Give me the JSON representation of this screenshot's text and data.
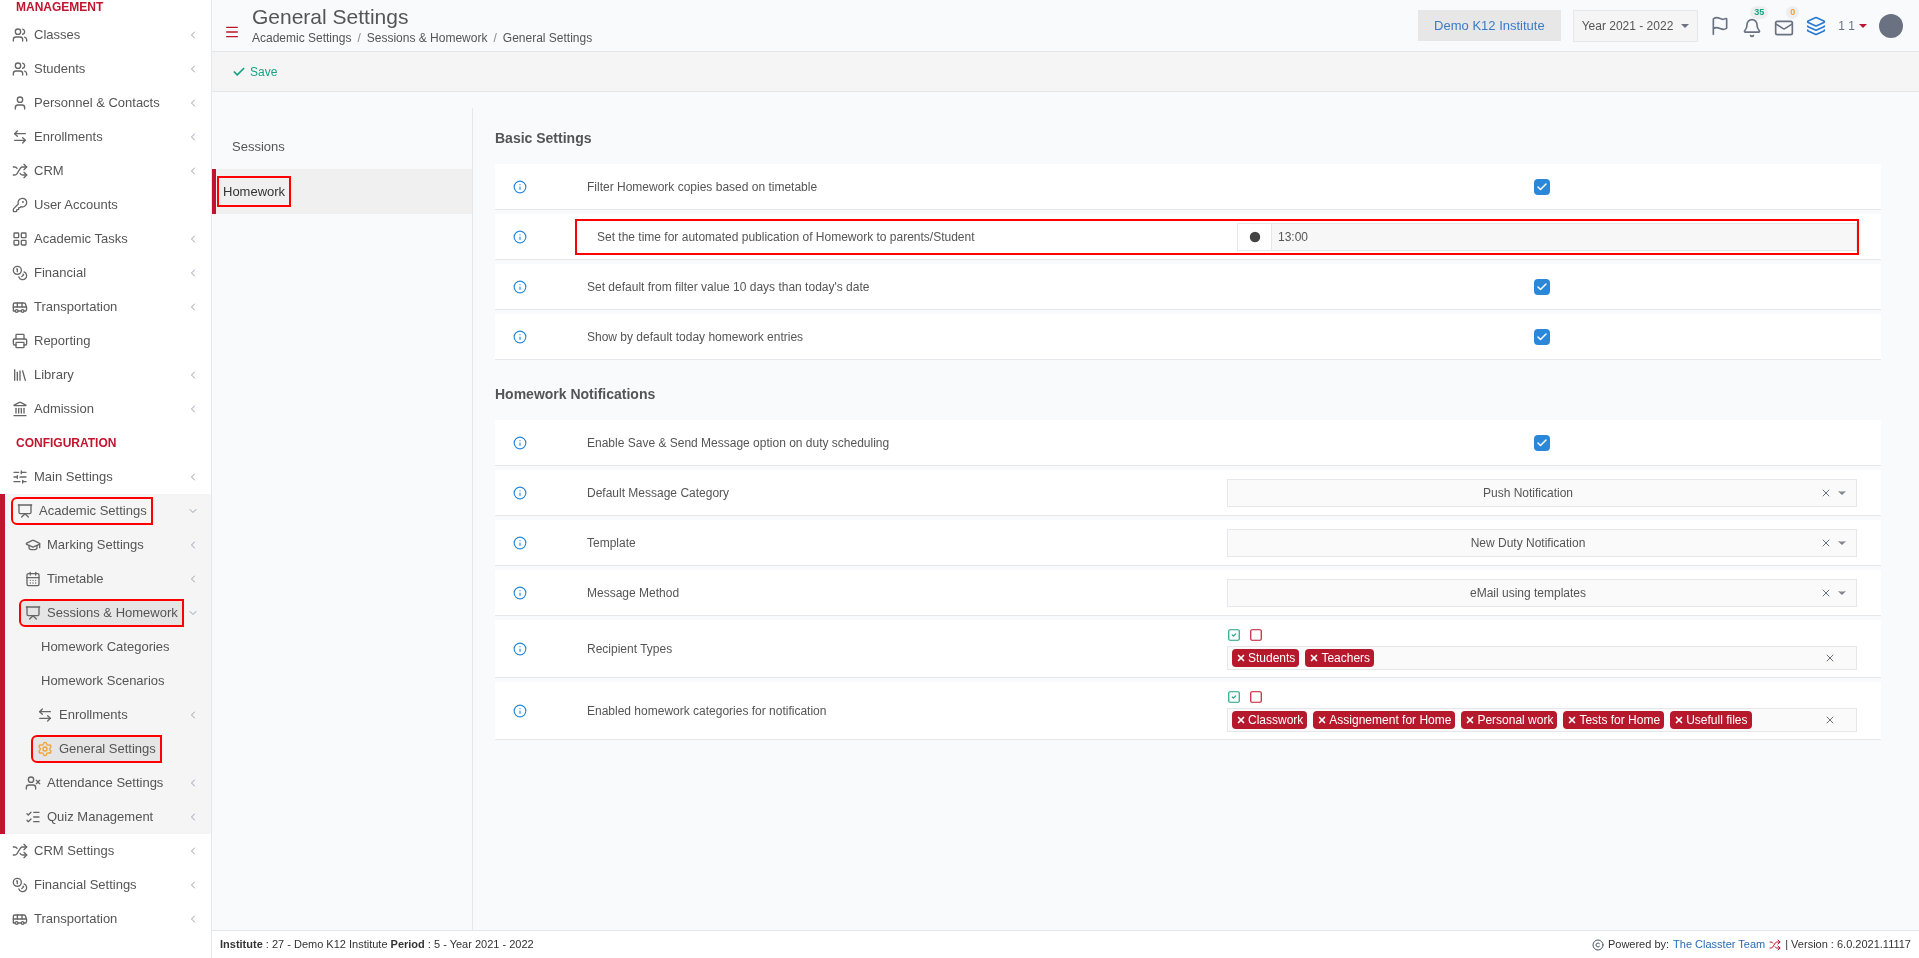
{
  "sidebar": [
    {
      "kind": "heading",
      "label": "MANAGEMENT"
    },
    {
      "kind": "item",
      "label": "Classes",
      "submenu": true,
      "expanded": false,
      "selected": false,
      "annotated": false
    },
    {
      "kind": "item",
      "label": "Students",
      "submenu": true,
      "expanded": false,
      "selected": false,
      "annotated": false
    },
    {
      "kind": "item",
      "label": "Personnel & Contacts",
      "submenu": true,
      "expanded": false,
      "selected": false,
      "annotated": false
    },
    {
      "kind": "item",
      "label": "Enrollments",
      "submenu": true,
      "expanded": false,
      "selected": false,
      "annotated": false
    },
    {
      "kind": "item",
      "label": "CRM",
      "submenu": true,
      "expanded": false,
      "selected": false,
      "annotated": false
    },
    {
      "kind": "item",
      "label": "User Accounts",
      "submenu": false,
      "selected": false,
      "annotated": false
    },
    {
      "kind": "item",
      "label": "Academic Tasks",
      "submenu": true,
      "expanded": false,
      "selected": false,
      "annotated": false
    },
    {
      "kind": "item",
      "label": "Financial",
      "submenu": true,
      "expanded": false,
      "selected": false,
      "annotated": false
    },
    {
      "kind": "item",
      "label": "Transportation",
      "submenu": true,
      "expanded": false,
      "selected": false,
      "annotated": false
    },
    {
      "kind": "item",
      "label": "Reporting",
      "submenu": false,
      "selected": false,
      "annotated": false
    },
    {
      "kind": "item",
      "label": "Library",
      "submenu": true,
      "expanded": false,
      "selected": false,
      "annotated": false
    },
    {
      "kind": "item",
      "label": "Admission",
      "submenu": true,
      "expanded": false,
      "selected": false,
      "annotated": false
    },
    {
      "kind": "heading",
      "label": "CONFIGURATION"
    },
    {
      "kind": "item",
      "label": "Main Settings",
      "submenu": true,
      "expanded": false,
      "selected": false,
      "annotated": false
    },
    {
      "kind": "item",
      "label": "Academic Settings",
      "submenu": true,
      "expanded": true,
      "selected": false,
      "annotated": true,
      "children": [
        {
          "label": "Marking Settings",
          "submenu": true,
          "expanded": false,
          "selected": false,
          "annotated": false
        },
        {
          "label": "Timetable",
          "submenu": true,
          "expanded": false,
          "selected": false,
          "annotated": false
        },
        {
          "label": "Sessions & Homework",
          "submenu": true,
          "expanded": true,
          "selected": true,
          "annotated": true,
          "children": [
            {
              "label": "Homework Categories",
              "submenu": false,
              "selected": false,
              "annotated": false,
              "icon": false
            },
            {
              "label": "Homework Scenarios",
              "submenu": false,
              "selected": false,
              "annotated": false,
              "icon": false
            },
            {
              "label": "Enrollments",
              "submenu": true,
              "expanded": false,
              "selected": false,
              "annotated": false,
              "icon": true
            },
            {
              "label": "General Settings",
              "submenu": false,
              "selected": true,
              "annotated": true,
              "icon": true
            }
          ]
        },
        {
          "label": "Attendance Settings",
          "submenu": true,
          "expanded": false,
          "selected": false,
          "annotated": false
        },
        {
          "label": "Quiz Management",
          "submenu": true,
          "expanded": false,
          "selected": false,
          "annotated": false
        }
      ]
    },
    {
      "kind": "item",
      "label": "CRM Settings",
      "submenu": true,
      "expanded": false,
      "selected": false,
      "annotated": false
    },
    {
      "kind": "item",
      "label": "Financial Settings",
      "submenu": true,
      "expanded": false,
      "selected": false,
      "annotated": false
    },
    {
      "kind": "item",
      "label": "Transportation",
      "submenu": true,
      "expanded": false,
      "selected": false,
      "annotated": false
    }
  ],
  "header": {
    "title": "General Settings",
    "breadcrumb": [
      "Academic Settings",
      "Sessions & Homework",
      "General Settings"
    ],
    "breadcrumb_separator": "/",
    "institute": "Demo K12 Institute",
    "year": "Year 2021 - 2022",
    "notifications": "35",
    "messages": "0",
    "user": "1 1"
  },
  "toolbar": {
    "save": "Save"
  },
  "subnav": [
    {
      "label": "Sessions",
      "selected": false,
      "annotated": false
    },
    {
      "label": "Homework",
      "selected": true,
      "annotated": true
    }
  ],
  "sections": [
    {
      "title": "Basic Settings",
      "rows": [
        {
          "kind": "checkbox",
          "label": "Filter Homework copies based on timetable",
          "checked": true,
          "annotated": false
        },
        {
          "kind": "time",
          "label": "Set the time for automated publication of Homework to parents/Student",
          "value": "13:00",
          "annotated": true
        },
        {
          "kind": "checkbox",
          "label": "Set default from filter value 10 days than today's date",
          "checked": true,
          "annotated": false
        },
        {
          "kind": "checkbox",
          "label": "Show by default today homework entries",
          "checked": true,
          "annotated": false
        }
      ]
    },
    {
      "title": "Homework Notifications",
      "rows": [
        {
          "kind": "checkbox",
          "label": "Enable Save & Send Message option on duty scheduling",
          "checked": true,
          "annotated": false
        },
        {
          "kind": "select",
          "label": "Default Message Category",
          "value": "Push Notification",
          "annotated": false
        },
        {
          "kind": "select",
          "label": "Template",
          "value": "New Duty Notification",
          "annotated": false
        },
        {
          "kind": "select",
          "label": "Message Method",
          "value": "eMail using templates",
          "annotated": false
        },
        {
          "kind": "tags",
          "label": "Recipient Types",
          "tags": [
            "Students",
            "Teachers"
          ],
          "annotated": false
        },
        {
          "kind": "tags",
          "label": "Enabled homework categories for notification",
          "tags": [
            "Classwork",
            "Assignement for Home",
            "Personal work",
            "Tests for Home",
            "Usefull files"
          ],
          "annotated": false
        }
      ]
    }
  ],
  "footer": {
    "info": "**Institute** : 27 - Demo K12 Institute **Period** : 5 - Year 2021 - 2022",
    "powered": "Powered by:",
    "link": "The Classter Team",
    "version": "| Version : 6.0.2021.11117"
  }
}
